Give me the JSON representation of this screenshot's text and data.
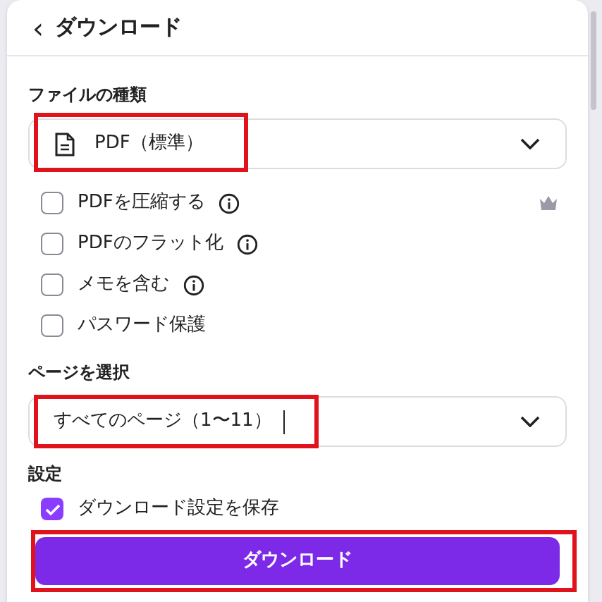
{
  "header": {
    "back_icon": "‹",
    "title": "ダウンロード"
  },
  "file_type": {
    "label": "ファイルの種類",
    "value": "PDF（標準）",
    "highlighted": true
  },
  "options": [
    {
      "label": "PDFを圧縮する",
      "checked": false,
      "info": true,
      "premium": true
    },
    {
      "label": "PDFのフラット化",
      "checked": false,
      "info": true,
      "premium": false
    },
    {
      "label": "メモを含む",
      "checked": false,
      "info": true,
      "premium": false
    },
    {
      "label": "パスワード保護",
      "checked": false,
      "info": false,
      "premium": false
    }
  ],
  "pages": {
    "label": "ページを選択",
    "value": "すべてのページ（1〜11）",
    "cursor": true,
    "highlighted": true
  },
  "settings": {
    "label": "設定",
    "option": {
      "label": "ダウンロード設定を保存",
      "checked": true
    }
  },
  "download_button": {
    "label": "ダウンロード",
    "highlighted": true
  }
}
